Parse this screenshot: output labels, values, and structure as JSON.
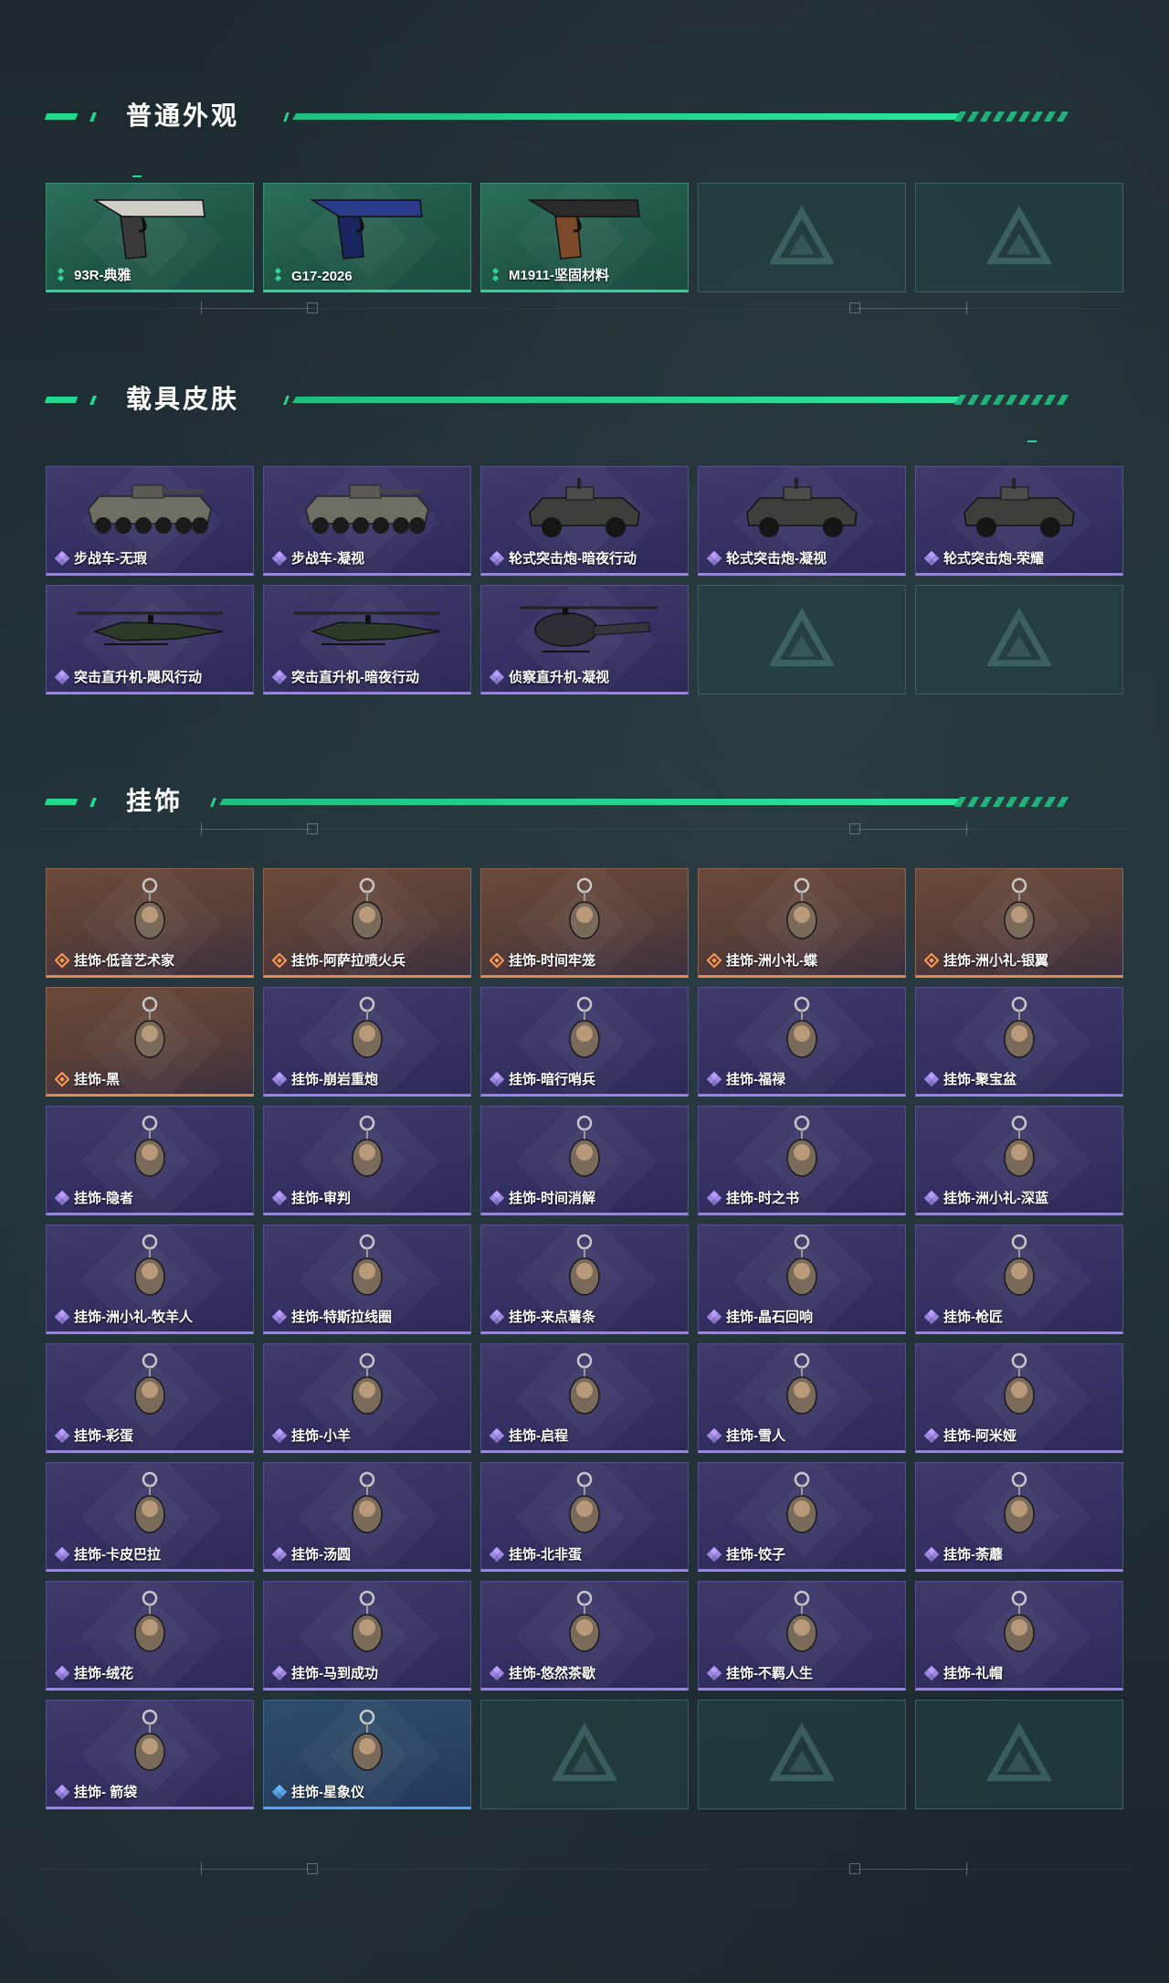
{
  "sections": [
    {
      "title": "普通外观",
      "items": [
        {
          "label": "93R-典雅",
          "rarity": "green",
          "icon": "pistol-silver-icon"
        },
        {
          "label": "G17-2026",
          "rarity": "green",
          "icon": "pistol-blue-icon"
        },
        {
          "label": "M1911-坚固材料",
          "rarity": "green",
          "icon": "pistol-black-icon"
        }
      ]
    },
    {
      "title": "载具皮肤",
      "items": [
        {
          "label": "步战车-无瑕",
          "rarity": "purple",
          "icon": "ifv-icon"
        },
        {
          "label": "步战车-凝视",
          "rarity": "purple",
          "icon": "ifv-icon"
        },
        {
          "label": "轮式突击炮-暗夜行动",
          "rarity": "purple",
          "icon": "assault-vehicle-icon"
        },
        {
          "label": "轮式突击炮-凝视",
          "rarity": "purple",
          "icon": "assault-vehicle-icon"
        },
        {
          "label": "轮式突击炮-荣耀",
          "rarity": "purple",
          "icon": "assault-vehicle-icon"
        },
        {
          "label": "突击直升机-飓风行动",
          "rarity": "purple",
          "icon": "attack-helicopter-icon"
        },
        {
          "label": "突击直升机-暗夜行动",
          "rarity": "purple",
          "icon": "attack-helicopter-icon"
        },
        {
          "label": "侦察直升机-凝视",
          "rarity": "purple",
          "icon": "scout-helicopter-icon"
        }
      ]
    },
    {
      "title": "挂饰",
      "items": [
        {
          "label": "挂饰-低音艺术家",
          "rarity": "orange",
          "icon": "charm-icon"
        },
        {
          "label": "挂饰-阿萨拉喷火兵",
          "rarity": "orange",
          "icon": "charm-icon"
        },
        {
          "label": "挂饰-时间牢笼",
          "rarity": "orange",
          "icon": "charm-icon"
        },
        {
          "label": "挂饰-洲小礼-蝶",
          "rarity": "orange",
          "icon": "charm-icon"
        },
        {
          "label": "挂饰-洲小礼-银翼",
          "rarity": "orange",
          "icon": "charm-icon"
        },
        {
          "label": "挂饰-黑",
          "rarity": "orange",
          "icon": "charm-icon"
        },
        {
          "label": "挂饰-崩岩重炮",
          "rarity": "purple",
          "icon": "charm-icon"
        },
        {
          "label": "挂饰-暗行哨兵",
          "rarity": "purple",
          "icon": "charm-icon"
        },
        {
          "label": "挂饰-福禄",
          "rarity": "purple",
          "icon": "charm-icon"
        },
        {
          "label": "挂饰-聚宝盆",
          "rarity": "purple",
          "icon": "charm-icon"
        },
        {
          "label": "挂饰-隐者",
          "rarity": "purple",
          "icon": "charm-icon"
        },
        {
          "label": "挂饰-审判",
          "rarity": "purple",
          "icon": "charm-icon"
        },
        {
          "label": "挂饰-时间消解",
          "rarity": "purple",
          "icon": "charm-icon"
        },
        {
          "label": "挂饰-时之书",
          "rarity": "purple",
          "icon": "charm-icon"
        },
        {
          "label": "挂饰-洲小礼-深蓝",
          "rarity": "purple",
          "icon": "charm-icon"
        },
        {
          "label": "挂饰-洲小礼-牧羊人",
          "rarity": "purple",
          "icon": "charm-icon"
        },
        {
          "label": "挂饰-特斯拉线圈",
          "rarity": "purple",
          "icon": "charm-icon"
        },
        {
          "label": "挂饰-来点薯条",
          "rarity": "purple",
          "icon": "charm-icon"
        },
        {
          "label": "挂饰-晶石回响",
          "rarity": "purple",
          "icon": "charm-icon"
        },
        {
          "label": "挂饰-枪匠",
          "rarity": "purple",
          "icon": "charm-icon"
        },
        {
          "label": "挂饰-彩蛋",
          "rarity": "purple",
          "icon": "charm-icon"
        },
        {
          "label": "挂饰-小羊",
          "rarity": "purple",
          "icon": "charm-icon"
        },
        {
          "label": "挂饰-启程",
          "rarity": "purple",
          "icon": "charm-icon"
        },
        {
          "label": "挂饰-雪人",
          "rarity": "purple",
          "icon": "charm-icon"
        },
        {
          "label": "挂饰-阿米娅",
          "rarity": "purple",
          "icon": "charm-icon"
        },
        {
          "label": "挂饰-卡皮巴拉",
          "rarity": "purple",
          "icon": "charm-icon"
        },
        {
          "label": "挂饰-汤圆",
          "rarity": "purple",
          "icon": "charm-icon"
        },
        {
          "label": "挂饰-北非蛋",
          "rarity": "purple",
          "icon": "charm-icon"
        },
        {
          "label": "挂饰-饺子",
          "rarity": "purple",
          "icon": "charm-icon"
        },
        {
          "label": "挂饰-荼蘼",
          "rarity": "purple",
          "icon": "charm-icon"
        },
        {
          "label": "挂饰-绒花",
          "rarity": "purple",
          "icon": "charm-icon"
        },
        {
          "label": "挂饰-马到成功",
          "rarity": "purple",
          "icon": "charm-icon"
        },
        {
          "label": "挂饰-悠然茶歇",
          "rarity": "purple",
          "icon": "charm-icon"
        },
        {
          "label": "挂饰-不羁人生",
          "rarity": "purple",
          "icon": "charm-icon"
        },
        {
          "label": "挂饰-礼帽",
          "rarity": "purple",
          "icon": "charm-icon"
        },
        {
          "label": "挂饰- 箭袋",
          "rarity": "purple",
          "icon": "charm-icon"
        },
        {
          "label": "挂饰-星象仪",
          "rarity": "blue",
          "icon": "charm-icon"
        }
      ]
    }
  ],
  "colors": {
    "accent": "#23d98f",
    "green_border": "#2ed49a",
    "purple_border": "#9c7ff0",
    "orange_border": "#e08a4c",
    "blue_border": "#4fa8ff"
  }
}
